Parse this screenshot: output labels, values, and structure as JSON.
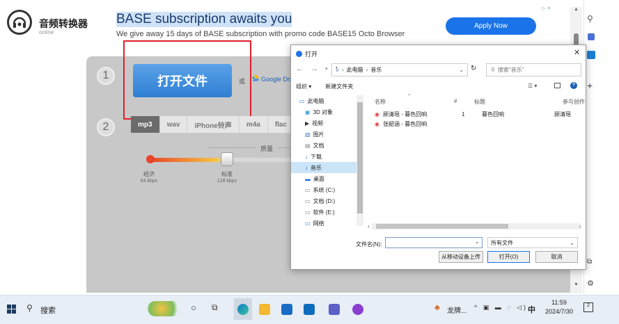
{
  "header": {
    "logo_name": "音频转换器",
    "logo_sub": "online"
  },
  "ad": {
    "title": "BASE subscription awaits you",
    "subtitle": "We give away 15 days of BASE subscription with promo code BASE15 Octo Browser",
    "button": "Apply Now"
  },
  "tool": {
    "step1": "1",
    "step2": "2",
    "open_button": "打开文件",
    "or": "或",
    "google_drive": "Google Dri",
    "formats": [
      "mp3",
      "wav",
      "iPhone铃声",
      "m4a",
      "flac"
    ],
    "quality_label": "质量",
    "quality_levels": [
      {
        "name": "经济",
        "kbps": "64 kbps"
      },
      {
        "name": "标准",
        "kbps": "128 kbps"
      }
    ]
  },
  "dialog": {
    "title": "打开",
    "path": [
      "此电脑",
      "音乐"
    ],
    "search_placeholder": "搜索\"音乐\"",
    "organize": "组织 ▾",
    "new_folder": "新建文件夹",
    "tree": [
      "此电脑",
      "3D 对象",
      "视频",
      "图片",
      "文档",
      "下载",
      "音乐",
      "桌面",
      "系统 (C:)",
      "文档 (D:)",
      "软件 (E:)",
      "网络"
    ],
    "tree_selected": "音乐",
    "columns": [
      "名称",
      "#",
      "标题",
      "参与创作"
    ],
    "files": [
      {
        "name": "顾清瑶 - 暮色回响",
        "num": "1",
        "title": "暮色回响",
        "artist": "顾清瑶"
      },
      {
        "name": "张韶涵 - 暮色回响",
        "num": "",
        "title": "",
        "artist": ""
      }
    ],
    "filename_label": "文件名(N):",
    "filename_value": "",
    "filetype": "所有文件",
    "upload_button": "从移动设备上传",
    "open_button": "打开(O)",
    "cancel_button": "取消"
  },
  "taskbar": {
    "search": "搜索",
    "weather": "龙牌...",
    "ime": "中",
    "time": "11:59",
    "date": "2024/7/30",
    "notifications": "2"
  },
  "colors": {
    "accent": "#1a73e8",
    "open_button": "#3b8ad8",
    "highlight": "#e0202a"
  }
}
